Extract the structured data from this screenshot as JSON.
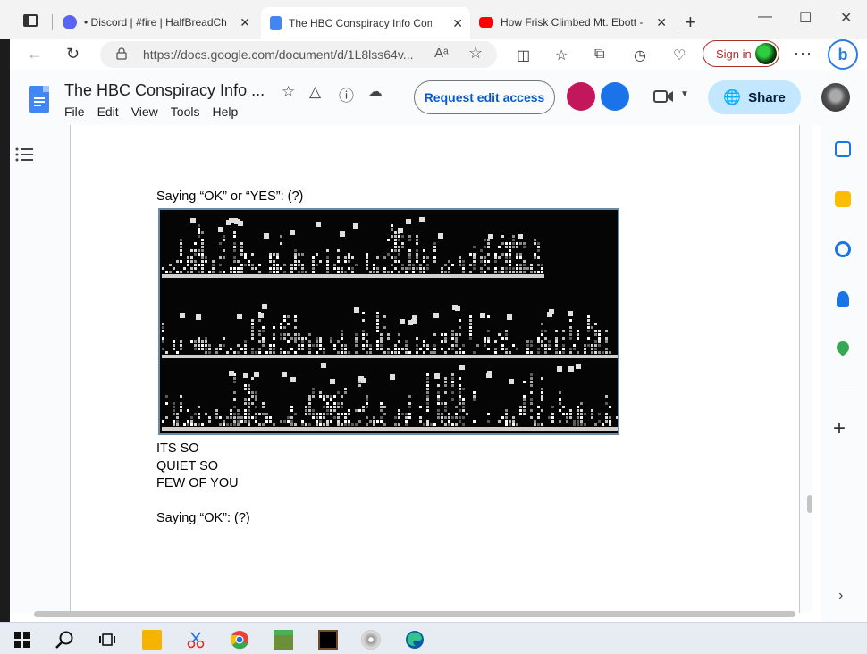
{
  "browser": {
    "tabs": [
      {
        "title": "• Discord | #fire | HalfBreadChat",
        "close": "✕"
      },
      {
        "title": "The HBC Conspiracy Info Compilation",
        "close": "✕"
      },
      {
        "title": "How Frisk Climbed Mt. Ebott - YouTube",
        "close": "✕"
      }
    ],
    "new_tab": "+",
    "window_controls": {
      "minimize": "—",
      "maximize": "☐",
      "close": "✕"
    },
    "address": "https://docs.google.com/document/d/1L8lss64v...",
    "read_aloud": "Aᵃ",
    "sign_in_label": "Sign in",
    "more_label": "···",
    "bing_label": "b"
  },
  "docs": {
    "title": "The HBC Conspiracy Info ...",
    "menu": [
      "File",
      "Edit",
      "View",
      "Tools",
      "Help"
    ],
    "request_edit_label": "Request edit access",
    "share_label": "Share"
  },
  "document": {
    "line1": "Saying “OK” or “YES”: (?)",
    "text_lines": [
      "ITS SO",
      "QUIET SO",
      "FEW OF YOU"
    ],
    "line2": "Saying “OK”: (?)"
  },
  "colors": {
    "docs_blue": "#4285f4",
    "share_bg": "#c2e7ff",
    "request_text": "#0b57d0",
    "signin_red": "#b02a2a"
  },
  "icons": {
    "side_panel": [
      "calendar-icon",
      "keep-icon",
      "tasks-icon",
      "contacts-icon",
      "maps-icon",
      "add-icon"
    ],
    "taskbar": [
      "windows-start-icon",
      "search-icon",
      "task-view-icon",
      "file-explorer-icon",
      "snipping-icon",
      "chrome-icon",
      "minecraft-icon",
      "minecraft-dungeons-icon",
      "disc-icon",
      "edge-icon"
    ]
  }
}
